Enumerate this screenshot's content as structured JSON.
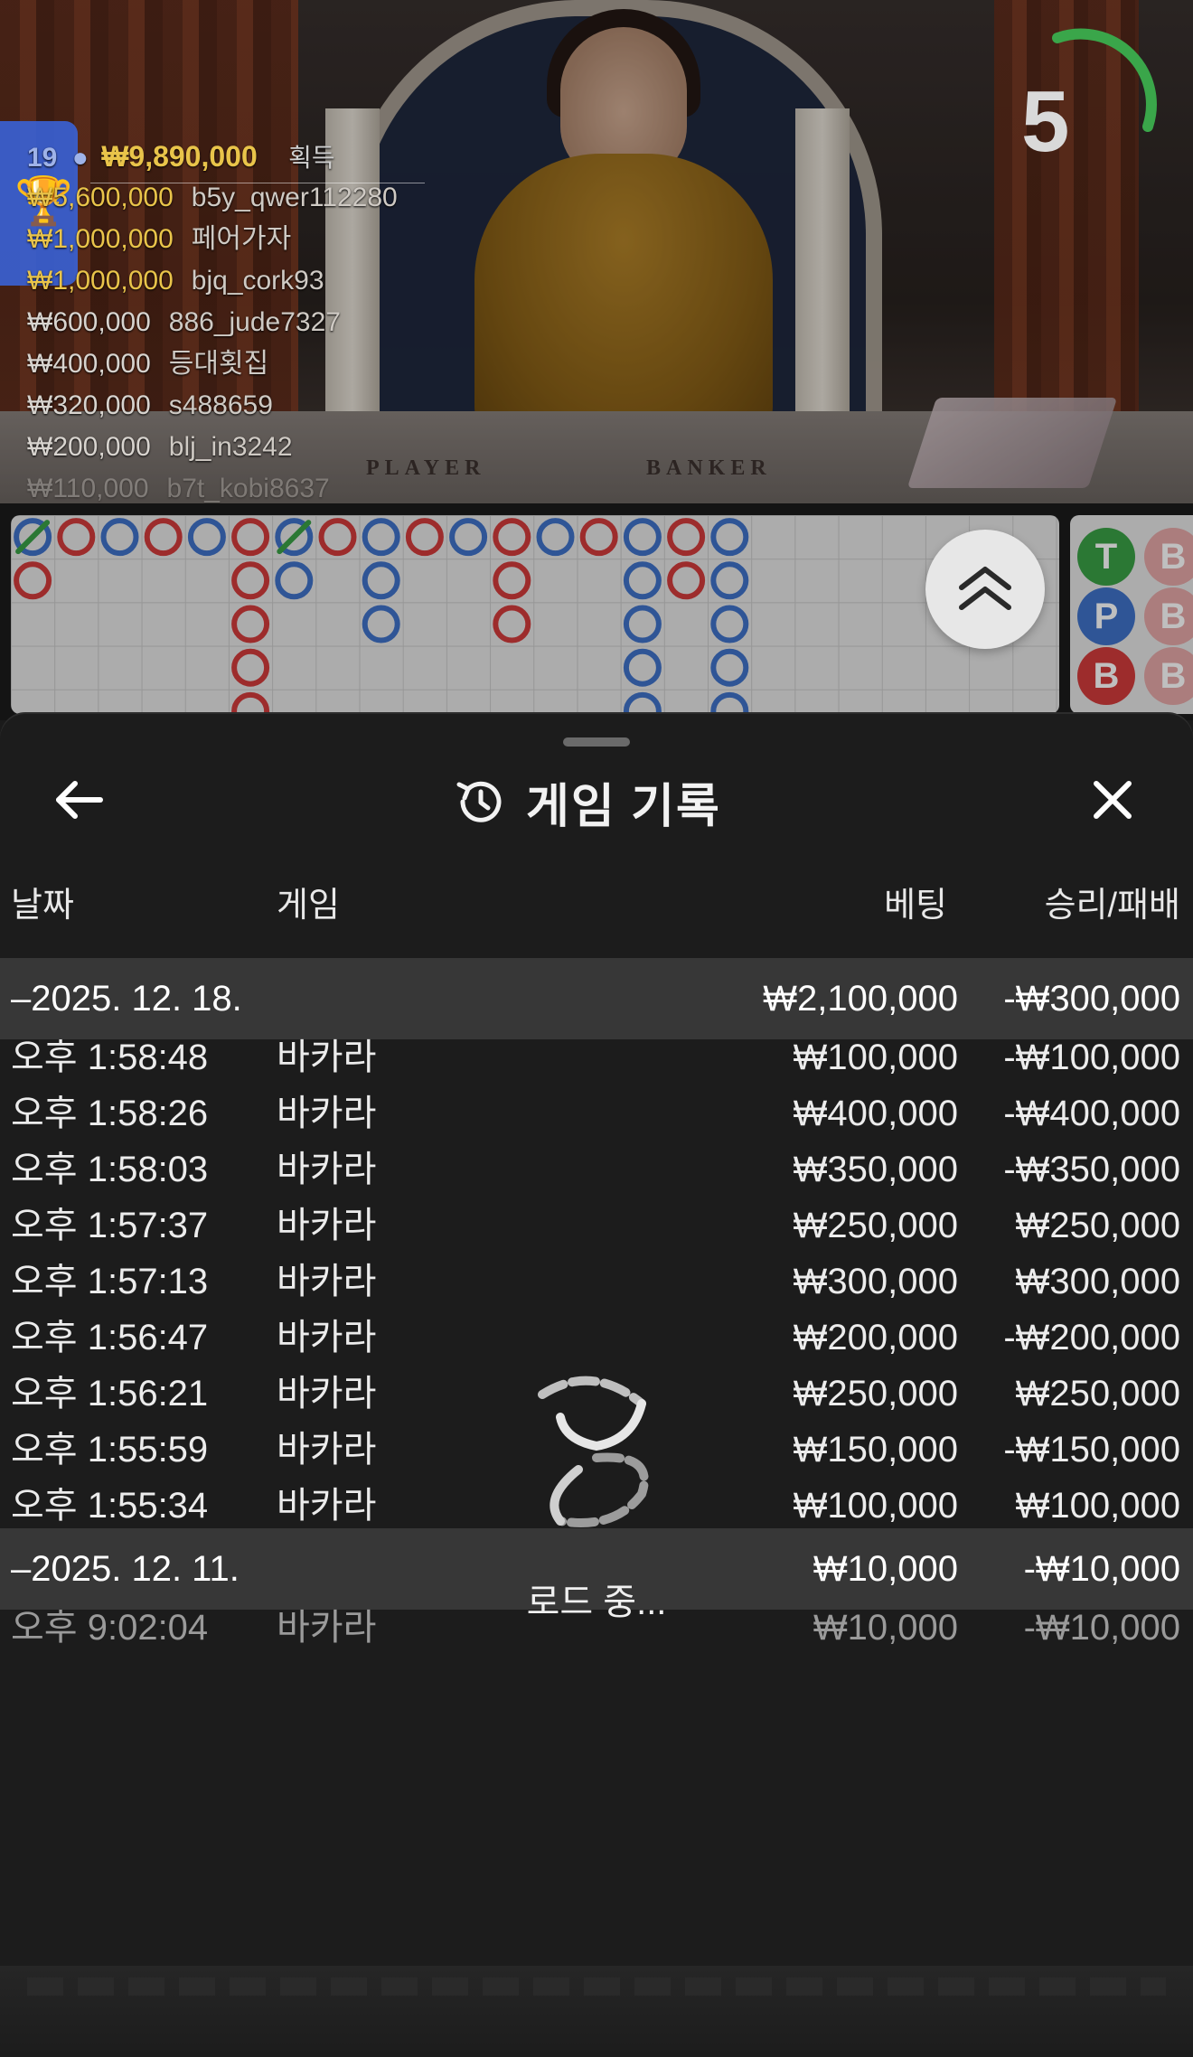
{
  "video": {
    "timer": "5",
    "felt_player": "PLAYER",
    "felt_banker": "BANKER",
    "winners_count": "19",
    "winners": [
      {
        "amount": "₩9,890,000",
        "name": "획득"
      },
      {
        "amount": "₩5,600,000",
        "name": "b5y_qwer112280"
      },
      {
        "amount": "₩1,000,000",
        "name": "페어가자"
      },
      {
        "amount": "₩1,000,000",
        "name": "bjq_cork93"
      },
      {
        "amount": "₩600,000",
        "name": "886_jude7327"
      },
      {
        "amount": "₩400,000",
        "name": "등대횟집"
      },
      {
        "amount": "₩320,000",
        "name": "s488659"
      },
      {
        "amount": "₩200,000",
        "name": "blj_in3242"
      },
      {
        "amount": "₩110,000",
        "name": "b7t_kobi8637"
      }
    ]
  },
  "road": {
    "columns": [
      [
        "P",
        "B"
      ],
      [
        "B"
      ],
      [
        "P"
      ],
      [
        "B"
      ],
      [
        "P"
      ],
      [
        "B",
        "B",
        "B",
        "B",
        "B"
      ],
      [
        "P",
        "P"
      ],
      [
        "B"
      ],
      [
        "P",
        "P",
        "P"
      ],
      [
        "B"
      ],
      [
        "P"
      ],
      [
        "B",
        "B",
        "B"
      ],
      [
        "P"
      ],
      [
        "B"
      ],
      [
        "P",
        "P",
        "P",
        "P",
        "P"
      ],
      [
        "B",
        "B"
      ],
      [
        "P",
        "P",
        "P",
        "P",
        "P"
      ]
    ],
    "predict": [
      "T",
      "P",
      "B"
    ]
  },
  "colors": {
    "banker": "#d23b3b",
    "player": "#3f72c9",
    "tie": "#3aa046"
  },
  "sheet": {
    "title": "게임 기록",
    "columns": {
      "date": "날짜",
      "game": "게임",
      "bet": "베팅",
      "result": "승리/패배"
    },
    "groups": [
      {
        "date": "–2025. 12. 18.",
        "bet": "₩2,100,000",
        "result": "-₩300,000",
        "rows": [
          {
            "time": "오후 1:58:48",
            "game": "바카라",
            "bet": "₩100,000",
            "result": "-₩100,000"
          },
          {
            "time": "오후 1:58:26",
            "game": "바카라",
            "bet": "₩400,000",
            "result": "-₩400,000"
          },
          {
            "time": "오후 1:58:03",
            "game": "바카라",
            "bet": "₩350,000",
            "result": "-₩350,000"
          },
          {
            "time": "오후 1:57:37",
            "game": "바카라",
            "bet": "₩250,000",
            "result": "₩250,000"
          },
          {
            "time": "오후 1:57:13",
            "game": "바카라",
            "bet": "₩300,000",
            "result": "₩300,000"
          },
          {
            "time": "오후 1:56:47",
            "game": "바카라",
            "bet": "₩200,000",
            "result": "-₩200,000"
          },
          {
            "time": "오후 1:56:21",
            "game": "바카라",
            "bet": "₩250,000",
            "result": "₩250,000"
          },
          {
            "time": "오후 1:55:59",
            "game": "바카라",
            "bet": "₩150,000",
            "result": "-₩150,000"
          },
          {
            "time": "오후 1:55:34",
            "game": "바카라",
            "bet": "₩100,000",
            "result": "₩100,000"
          }
        ]
      },
      {
        "date": "–2025. 12. 11.",
        "bet": "₩10,000",
        "result": "-₩10,000",
        "rows": [
          {
            "time": "오후 9:02:04",
            "game": "바카라",
            "bet": "₩10,000",
            "result": "-₩10,000"
          }
        ]
      }
    ],
    "loading": "로드 중..."
  }
}
